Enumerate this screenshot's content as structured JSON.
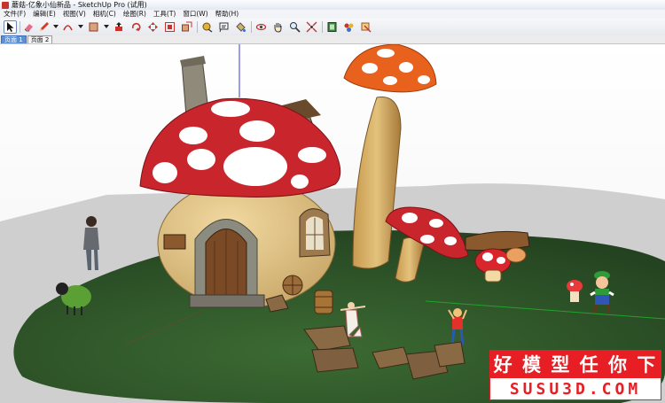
{
  "window": {
    "title": "蘑菇-亿象小仙新品 - SketchUp Pro (试用)"
  },
  "menu": [
    "文件(F)",
    "编辑(E)",
    "视图(V)",
    "相机(C)",
    "绘图(R)",
    "工具(T)",
    "窗口(W)",
    "帮助(H)"
  ],
  "toolbar": {
    "tools": [
      "select-tool",
      "eraser-tool",
      "pencil-tool",
      "arc-tool",
      "rectangle-tool",
      "push-pull-tool",
      "rotate-tool",
      "move-tool",
      "offset-tool",
      "scale-tool",
      "tape-measure-tool",
      "text-tool",
      "paint-bucket-tool",
      "orbit-tool",
      "pan-tool",
      "zoom-tool",
      "zoom-extents-tool",
      "components-tool",
      "materials-tool",
      "section-tool",
      "warehouse-tool"
    ]
  },
  "scenes": {
    "tabs": [
      {
        "label": "页面 1",
        "active": true
      },
      {
        "label": "页面 2",
        "active": false
      }
    ]
  },
  "watermark": {
    "line1": [
      "好",
      "模",
      "型",
      "任",
      "你",
      "下"
    ],
    "line2": "SUSU3D.COM"
  },
  "colors": {
    "ground": "#2f5a2b",
    "sky": "#ffffff",
    "cap_red": "#c9252c",
    "cap_orange": "#e8621e",
    "accent_tab": "#5b90d6",
    "watermark_red": "#e81e25"
  }
}
